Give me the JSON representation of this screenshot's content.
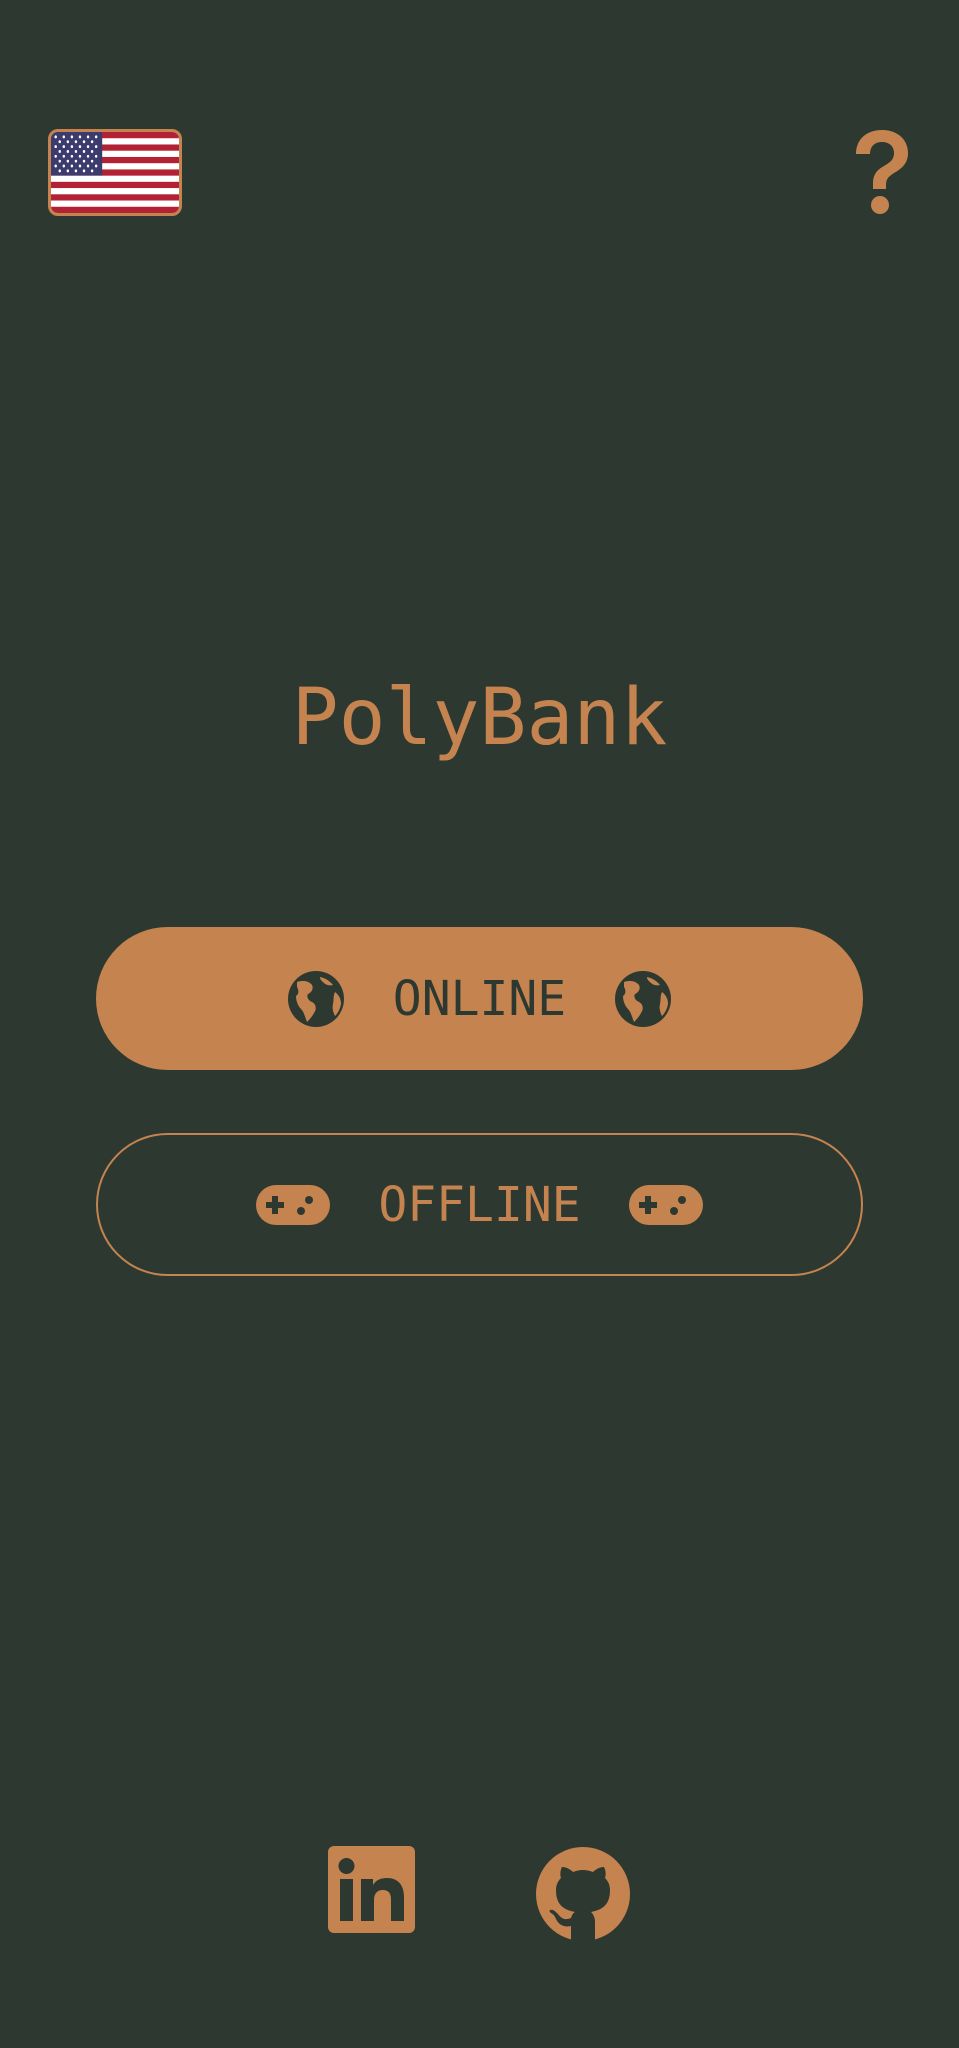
{
  "header": {
    "language_flag": "us-flag-icon",
    "help_icon": "question-mark-icon"
  },
  "app": {
    "title": "PolyBank"
  },
  "buttons": {
    "online_label": "ONLINE",
    "online_icon": "globe-icon",
    "offline_label": "OFFLINE",
    "offline_icon": "gamepad-icon"
  },
  "footer": {
    "links": [
      "linkedin-icon",
      "github-icon"
    ]
  },
  "colors": {
    "background": "#2d3930",
    "accent": "#c4834f"
  }
}
